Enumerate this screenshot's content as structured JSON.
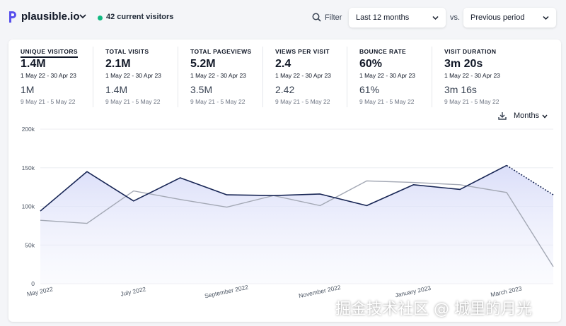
{
  "header": {
    "site_name": "plausible.io",
    "current_visitors": "42 current visitors",
    "filter_label": "Filter",
    "period_select": "Last 12 months",
    "vs_label": "vs.",
    "compare_select": "Previous period",
    "brand_color": "#5850ec",
    "live_color": "#10b981"
  },
  "metrics": [
    {
      "label": "UNIQUE VISITORS",
      "value": "1.4M",
      "range": "1 May 22 - 30 Apr 23",
      "prev_value": "1M",
      "prev_range": "9 May 21 - 5 May 22",
      "active": true
    },
    {
      "label": "TOTAL VISITS",
      "value": "2.1M",
      "range": "1 May 22 - 30 Apr 23",
      "prev_value": "1.4M",
      "prev_range": "9 May 21 - 5 May 22"
    },
    {
      "label": "TOTAL PAGEVIEWS",
      "value": "5.2M",
      "range": "1 May 22 - 30 Apr 23",
      "prev_value": "3.5M",
      "prev_range": "9 May 21 - 5 May 22"
    },
    {
      "label": "VIEWS PER VISIT",
      "value": "2.4",
      "range": "1 May 22 - 30 Apr 23",
      "prev_value": "2.42",
      "prev_range": "9 May 21 - 5 May 22"
    },
    {
      "label": "BOUNCE RATE",
      "value": "60%",
      "range": "1 May 22 - 30 Apr 23",
      "prev_value": "61%",
      "prev_range": "9 May 21 - 5 May 22"
    },
    {
      "label": "VISIT DURATION",
      "value": "3m 20s",
      "range": "1 May 22 - 30 Apr 23",
      "prev_value": "3m 16s",
      "prev_range": "9 May 21 - 5 May 22"
    }
  ],
  "chart_controls": {
    "interval_label": "Months",
    "download_icon": "download-icon"
  },
  "chart_data": {
    "type": "line",
    "ylim": [
      0,
      200000
    ],
    "yticks": [
      0,
      50000,
      100000,
      150000,
      200000
    ],
    "ytick_labels": [
      "0",
      "50k",
      "100k",
      "150k",
      "200k"
    ],
    "categories": [
      "May 2022",
      "Jun 2022",
      "Jul 2022",
      "Aug 2022",
      "Sep 2022",
      "Oct 2022",
      "Nov 2022",
      "Dec 2022",
      "Jan 2023",
      "Feb 2023",
      "Mar 2023",
      "Apr 2023"
    ],
    "xtick_labels": [
      {
        "index": 0,
        "text": "May 2022"
      },
      {
        "index": 2,
        "text": "July 2022"
      },
      {
        "index": 4,
        "text": "September 2022"
      },
      {
        "index": 6,
        "text": "November 2022"
      },
      {
        "index": 8,
        "text": "January 2023"
      },
      {
        "index": 10,
        "text": "March 2023"
      }
    ],
    "grid": true,
    "series": [
      {
        "role": "current",
        "values": [
          94000,
          145000,
          107000,
          137000,
          115000,
          114000,
          116000,
          101000,
          128000,
          122000,
          153000,
          115000
        ],
        "color": "#172554",
        "fill": "#e0e3fb",
        "partial_last": true
      },
      {
        "role": "previous",
        "values": [
          82000,
          78000,
          120000,
          109000,
          99000,
          114000,
          101000,
          133000,
          131000,
          128000,
          118000,
          22000
        ],
        "color": "#a3a8b4"
      }
    ]
  },
  "watermark": "掘金技术社区 @ 城里的月光"
}
